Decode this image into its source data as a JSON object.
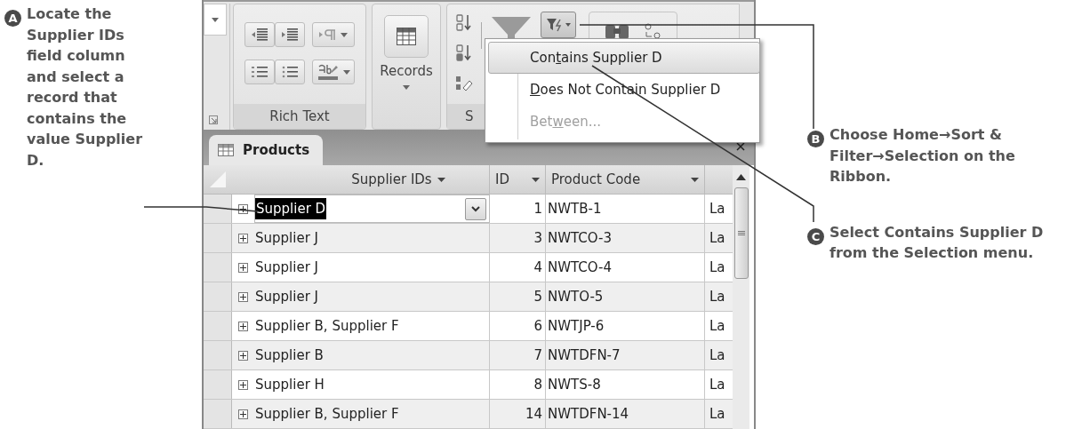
{
  "callouts": [
    {
      "letter": "A",
      "text": "Locate the Supplier IDs field column and select a record that contains the value Supplier D."
    },
    {
      "letter": "B",
      "text": "Choose Home→Sort & Filter→Selection on the Ribbon."
    },
    {
      "letter": "C",
      "text": "Select Contains Supplier D from the Selection menu."
    }
  ],
  "ribbon": {
    "groups": [
      {
        "kind": "rich_text",
        "label": "Rich Text"
      },
      {
        "kind": "records",
        "label": "Records"
      },
      {
        "kind": "sort_filter",
        "label": "S"
      }
    ]
  },
  "selection_menu": {
    "items": [
      {
        "text_before": "Con",
        "access_key": "t",
        "text_after": "ains Supplier D",
        "selected": true,
        "disabled": false
      },
      {
        "access_key": "D",
        "text_after": "oes Not Contain Supplier D",
        "selected": false,
        "disabled": false
      },
      {
        "text_before": "Bet",
        "access_key": "w",
        "text_after": "een...",
        "selected": false,
        "disabled": true
      }
    ]
  },
  "document_tab": {
    "title": "Products"
  },
  "table": {
    "columns": [
      "Supplier IDs",
      "ID",
      "Product Code"
    ],
    "rows": [
      {
        "supplier_ids": "Supplier D",
        "id": "1",
        "product_code": "NWTB-1",
        "column_4": "La",
        "selected": true
      },
      {
        "supplier_ids": "Supplier J",
        "id": "3",
        "product_code": "NWTCO-3",
        "column_4": "La",
        "selected": false
      },
      {
        "supplier_ids": "Supplier J",
        "id": "4",
        "product_code": "NWTCO-4",
        "column_4": "La",
        "selected": false
      },
      {
        "supplier_ids": "Supplier J",
        "id": "5",
        "product_code": "NWTO-5",
        "column_4": "La",
        "selected": false
      },
      {
        "supplier_ids": "Supplier B, Supplier F",
        "id": "6",
        "product_code": "NWTJP-6",
        "column_4": "La",
        "selected": false
      },
      {
        "supplier_ids": "Supplier B",
        "id": "7",
        "product_code": "NWTDFN-7",
        "column_4": "La",
        "selected": false
      },
      {
        "supplier_ids": "Supplier H",
        "id": "8",
        "product_code": "NWTS-8",
        "column_4": "La",
        "selected": false
      },
      {
        "supplier_ids": "Supplier B, Supplier F",
        "id": "14",
        "product_code": "NWTDFN-14",
        "column_4": "La",
        "selected": false
      }
    ]
  }
}
